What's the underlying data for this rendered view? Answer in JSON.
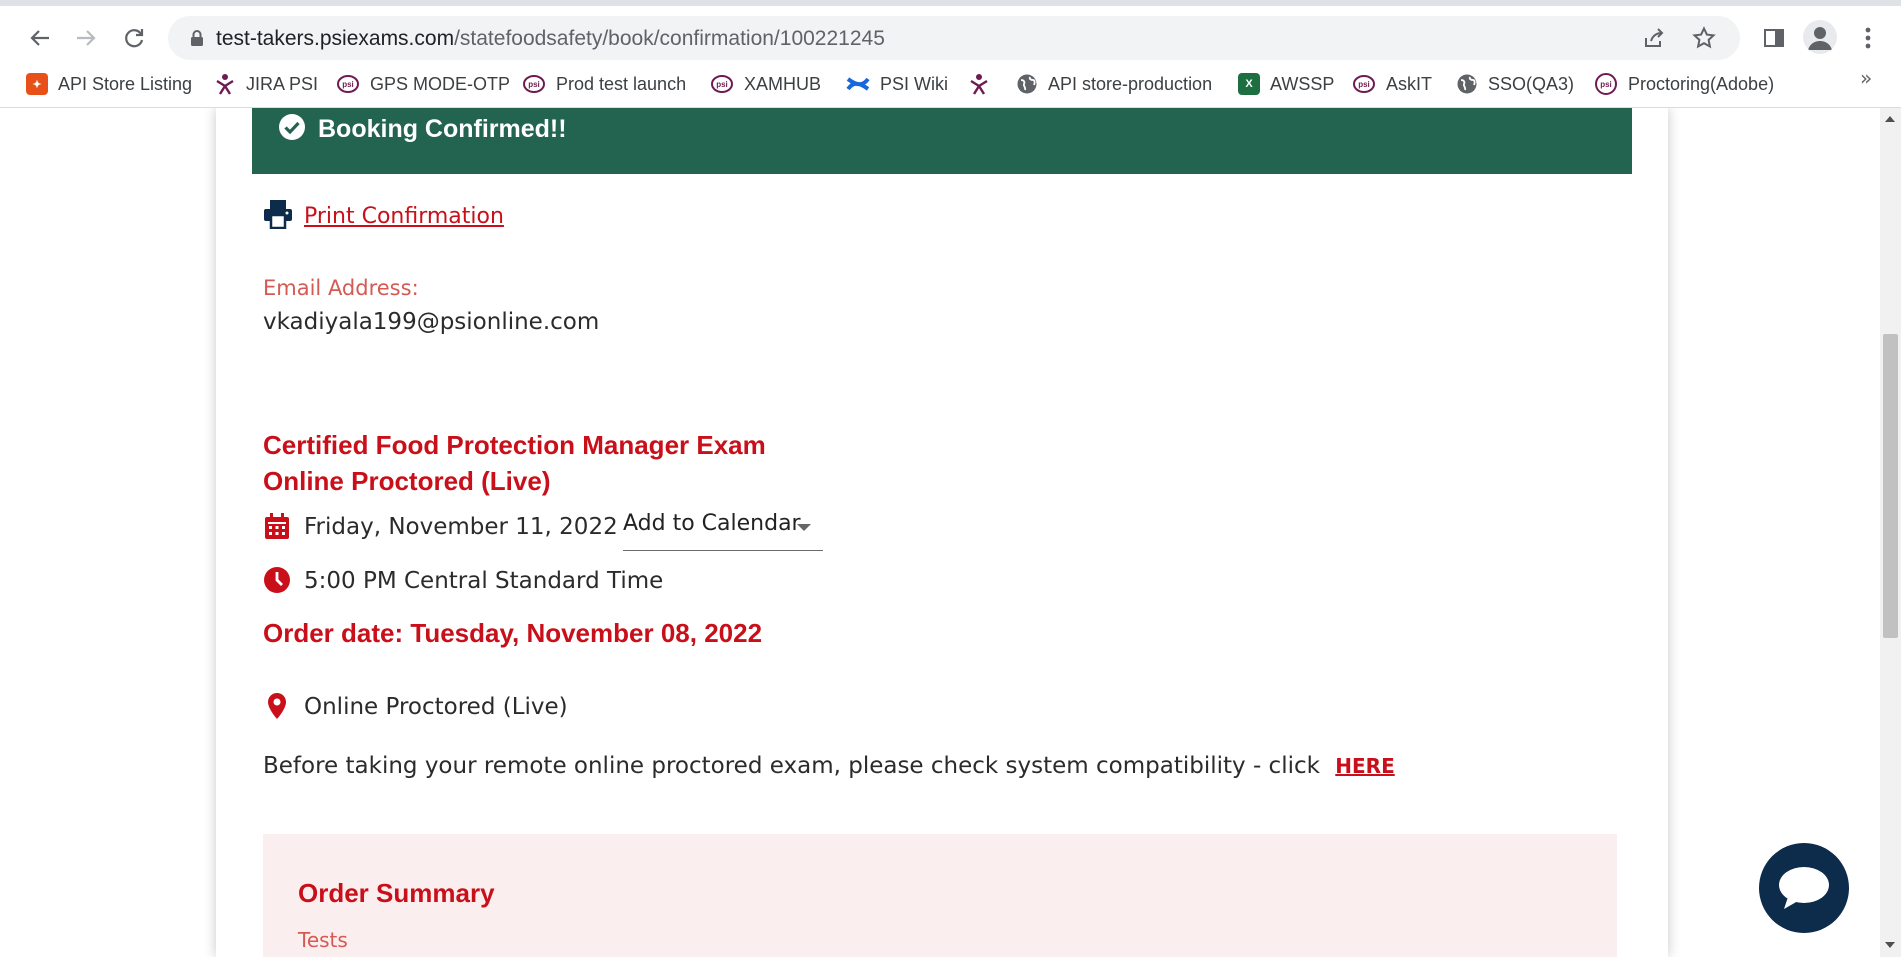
{
  "browser": {
    "url_host": "test-takers.psiexams.com",
    "url_path": "/statefoodsafety/book/confirmation/100221245",
    "bookmarks": [
      {
        "label": "API Store Listing",
        "icon": "api-store-icon",
        "color": "#e8501a"
      },
      {
        "label": "JIRA PSI",
        "icon": "psi-figure-icon",
        "color": "#6e1b52"
      },
      {
        "label": "GPS MODE-OTP",
        "icon": "psi-logo-icon",
        "color": "#6e1b52"
      },
      {
        "label": "Prod test launch",
        "icon": "psi-logo-icon",
        "color": "#6e1b52"
      },
      {
        "label": "XAMHUB",
        "icon": "psi-logo-icon",
        "color": "#6e1b52"
      },
      {
        "label": "PSI Wiki",
        "icon": "confluence-icon",
        "color": "#1868db"
      },
      {
        "label": "",
        "icon": "psi-figure-icon",
        "color": "#6e1b52"
      },
      {
        "label": "API store-production",
        "icon": "globe-icon",
        "color": "#5f6368"
      },
      {
        "label": "AWSSP",
        "icon": "excel-icon",
        "color": "#1d6f42"
      },
      {
        "label": "AskIT",
        "icon": "psi-logo-icon",
        "color": "#6e1b52"
      },
      {
        "label": "SSO(QA3)",
        "icon": "globe-icon",
        "color": "#5f6368"
      },
      {
        "label": "Proctoring(Adobe)",
        "icon": "psi-logo-icon",
        "color": "#6e1b52"
      }
    ],
    "overflow_label": "»"
  },
  "page": {
    "banner": "Booking Confirmed!!",
    "print_link": "Print Confirmation",
    "email_label": "Email Address:",
    "email_value": "vkadiyala199@psionline.com",
    "exam_title_line1": "Certified Food Protection Manager Exam",
    "exam_title_line2": "Online Proctored (Live)",
    "exam_date": "Friday, November 11, 2022",
    "add_to_calendar": "Add to Calendar",
    "exam_time": "5:00 PM  Central Standard Time",
    "order_date": "Order date: Tuesday, November 08, 2022",
    "location": "Online Proctored (Live)",
    "compat_text": "Before taking your remote online proctored exam, please check system compatibility - click",
    "compat_link": "HERE",
    "summary_title": "Order Summary",
    "summary_sub": "Tests"
  },
  "colors": {
    "brand_red": "#c9101a",
    "banner_green": "#236451",
    "chat_navy": "#0d2b4b"
  }
}
